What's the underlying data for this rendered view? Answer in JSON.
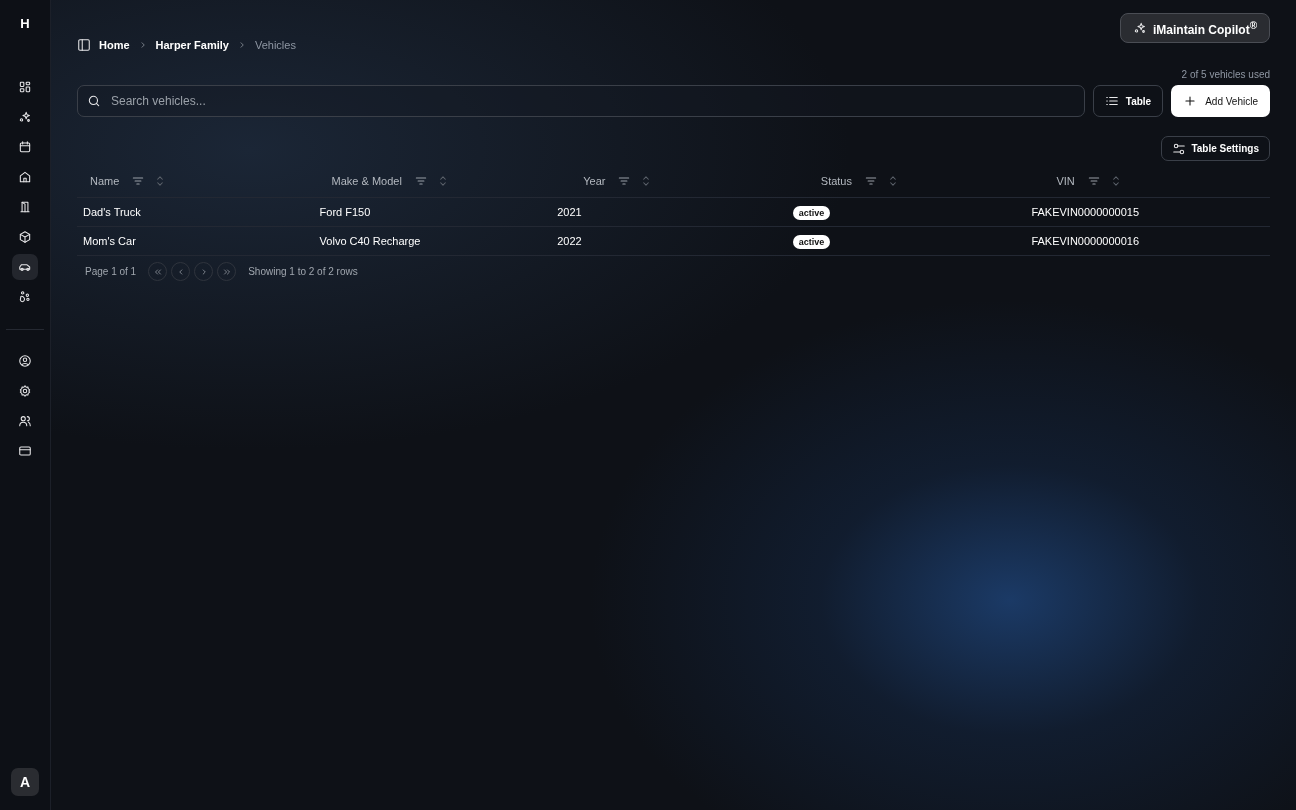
{
  "sidebar": {
    "logo": "H",
    "items": [
      {
        "kind": "dashboard",
        "selected": false
      },
      {
        "kind": "sparkles",
        "selected": false
      },
      {
        "kind": "calendar",
        "selected": false
      },
      {
        "kind": "home",
        "selected": false
      },
      {
        "kind": "door",
        "selected": false
      },
      {
        "kind": "box",
        "selected": false
      },
      {
        "kind": "car",
        "selected": true
      },
      {
        "kind": "paw",
        "selected": false
      }
    ],
    "bottom_items": [
      {
        "kind": "user"
      },
      {
        "kind": "settings"
      },
      {
        "kind": "users"
      },
      {
        "kind": "card"
      }
    ],
    "avatar": "A"
  },
  "copilot": {
    "label": "iMaintain Copilot",
    "mark": "®"
  },
  "breadcrumb": [
    "Home",
    "Harper Family",
    "Vehicles"
  ],
  "usage": "2 of 5 vehicles used",
  "search": {
    "placeholder": "Search vehicles..."
  },
  "view_button": "Table",
  "add_button": "Add Vehicle",
  "settings_button": "Table Settings",
  "table": {
    "columns": [
      "Name",
      "Make & Model",
      "Year",
      "Status",
      "VIN"
    ],
    "rows": [
      {
        "name": "Dad's Truck",
        "model": "Ford F150",
        "year": "2021",
        "status": "active",
        "vin": "FAKEVIN0000000015"
      },
      {
        "name": "Mom's Car",
        "model": "Volvo C40 Recharge",
        "year": "2022",
        "status": "active",
        "vin": "FAKEVIN0000000016"
      }
    ]
  },
  "pagination": {
    "page": "Page 1 of 1",
    "showing": "Showing 1 to 2 of 2 rows"
  }
}
